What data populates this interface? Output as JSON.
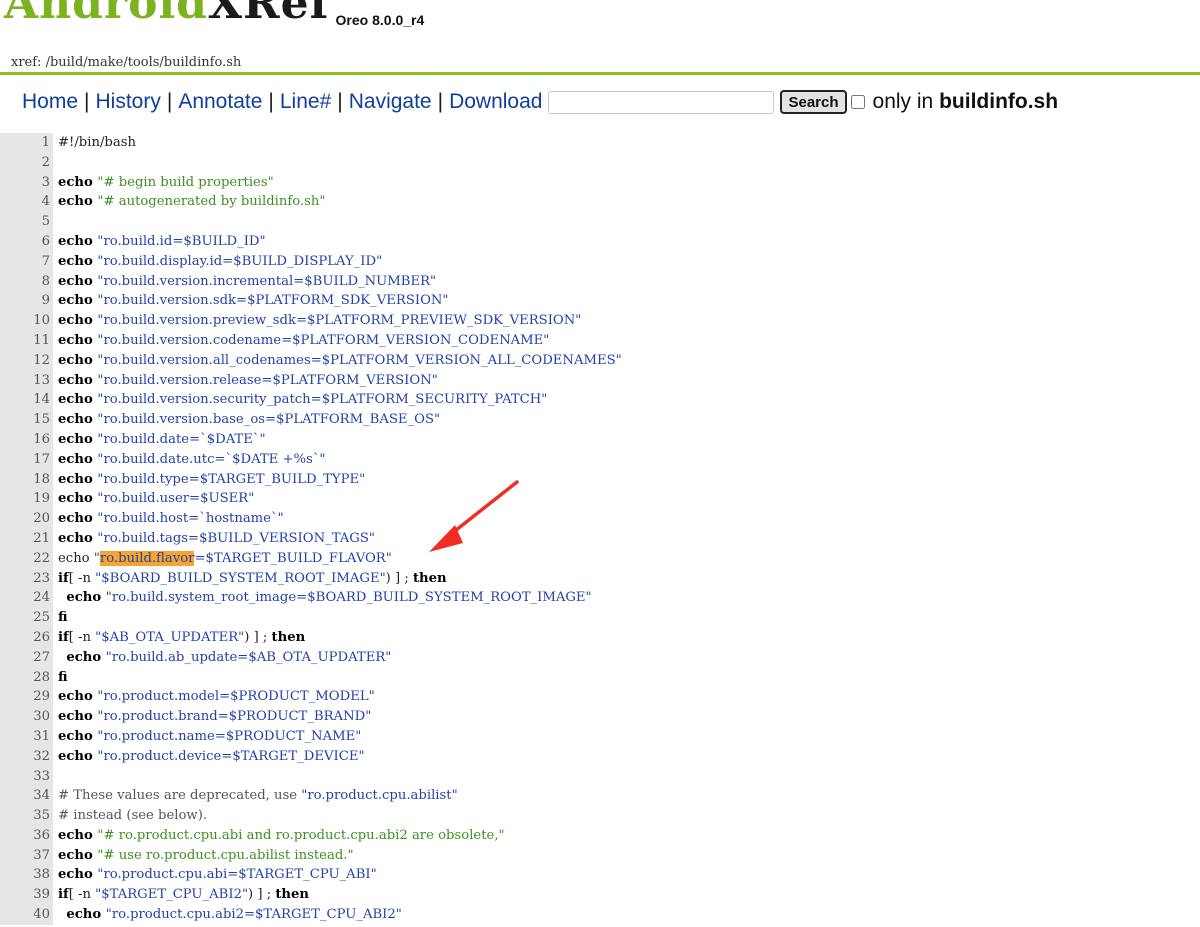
{
  "brand": {
    "title_prefix": "Android",
    "title_suffix": "XRef",
    "version": "Oreo 8.0.0_r4"
  },
  "path": {
    "label": "xref:",
    "segments": [
      "/build",
      "/make",
      "/tools",
      "/buildinfo.sh"
    ]
  },
  "nav": {
    "items": [
      "Home",
      "History",
      "Annotate",
      "Line#",
      "Navigate",
      "Download"
    ],
    "search_value": "",
    "search_button": "Search",
    "only_in_label": "only in",
    "only_in_file": "buildinfo.sh",
    "only_in_checked": false
  },
  "colors": {
    "brand_green": "#7cb21f",
    "link_blue": "#0f3f9c",
    "highlight_orange": "#f7a531",
    "arrow_red": "#ee2e24"
  },
  "code": {
    "lines": [
      {
        "n": "1",
        "t": [
          [
            "",
            "#!/bin/bash"
          ]
        ]
      },
      {
        "n": "2",
        "t": []
      },
      {
        "n": "3",
        "t": [
          [
            "kw",
            "echo "
          ],
          [
            "cmt",
            "\"# begin build properties\""
          ]
        ]
      },
      {
        "n": "4",
        "t": [
          [
            "kw",
            "echo "
          ],
          [
            "cmt",
            "\"# autogenerated by buildinfo.sh\""
          ]
        ]
      },
      {
        "n": "5",
        "t": []
      },
      {
        "n": "6",
        "t": [
          [
            "kw",
            "echo "
          ],
          [
            "str",
            "\"ro.build.id=$BUILD_ID\""
          ]
        ]
      },
      {
        "n": "7",
        "t": [
          [
            "kw",
            "echo "
          ],
          [
            "str",
            "\"ro.build.display.id=$BUILD_DISPLAY_ID\""
          ]
        ]
      },
      {
        "n": "8",
        "t": [
          [
            "kw",
            "echo "
          ],
          [
            "str",
            "\"ro.build.version.incremental=$BUILD_NUMBER\""
          ]
        ]
      },
      {
        "n": "9",
        "t": [
          [
            "kw",
            "echo "
          ],
          [
            "str",
            "\"ro.build.version.sdk=$PLATFORM_SDK_VERSION\""
          ]
        ]
      },
      {
        "n": "10",
        "t": [
          [
            "kw",
            "echo "
          ],
          [
            "str",
            "\"ro.build.version.preview_sdk=$PLATFORM_PREVIEW_SDK_VERSION\""
          ]
        ]
      },
      {
        "n": "11",
        "t": [
          [
            "kw",
            "echo "
          ],
          [
            "str",
            "\"ro.build.version.codename=$PLATFORM_VERSION_CODENAME\""
          ]
        ]
      },
      {
        "n": "12",
        "t": [
          [
            "kw",
            "echo "
          ],
          [
            "str",
            "\"ro.build.version.all_codenames=$PLATFORM_VERSION_ALL_CODENAMES\""
          ]
        ]
      },
      {
        "n": "13",
        "t": [
          [
            "kw",
            "echo "
          ],
          [
            "str",
            "\"ro.build.version.release=$PLATFORM_VERSION\""
          ]
        ]
      },
      {
        "n": "14",
        "t": [
          [
            "kw",
            "echo "
          ],
          [
            "str",
            "\"ro.build.version.security_patch=$PLATFORM_SECURITY_PATCH\""
          ]
        ]
      },
      {
        "n": "15",
        "t": [
          [
            "kw",
            "echo "
          ],
          [
            "str",
            "\"ro.build.version.base_os=$PLATFORM_BASE_OS\""
          ]
        ]
      },
      {
        "n": "16",
        "t": [
          [
            "kw",
            "echo "
          ],
          [
            "str",
            "\"ro.build.date=`$DATE`\""
          ]
        ]
      },
      {
        "n": "17",
        "t": [
          [
            "kw",
            "echo "
          ],
          [
            "str",
            "\"ro.build.date.utc=`$DATE +%s`\""
          ]
        ]
      },
      {
        "n": "18",
        "t": [
          [
            "kw",
            "echo "
          ],
          [
            "str",
            "\"ro.build.type=$TARGET_BUILD_TYPE\""
          ]
        ]
      },
      {
        "n": "19",
        "t": [
          [
            "kw",
            "echo "
          ],
          [
            "str",
            "\"ro.build.user=$USER\""
          ]
        ]
      },
      {
        "n": "20",
        "t": [
          [
            "kw",
            "echo "
          ],
          [
            "str",
            "\"ro.build.host=`hostname`\""
          ]
        ]
      },
      {
        "n": "21",
        "t": [
          [
            "kw",
            "echo "
          ],
          [
            "str",
            "\"ro.build.tags=$BUILD_VERSION_TAGS\""
          ]
        ]
      },
      {
        "n": "22",
        "t": [
          [
            "",
            "echo "
          ],
          [
            "str",
            "\""
          ],
          [
            "hl",
            "ro.build.flavor"
          ],
          [
            "str",
            "=$TARGET_BUILD_FLAVOR\""
          ]
        ]
      },
      {
        "n": "23",
        "t": [
          [
            "kw",
            "if"
          ],
          [
            "",
            "[ -n "
          ],
          [
            "str",
            "\"$BOARD_BUILD_SYSTEM_ROOT_IMAGE\""
          ],
          [
            "",
            ") ] ; "
          ],
          [
            "kw",
            "then"
          ]
        ]
      },
      {
        "n": "24",
        "t": [
          [
            "",
            "  "
          ],
          [
            "kw",
            "echo "
          ],
          [
            "str",
            "\"ro.build.system_root_image=$BOARD_BUILD_SYSTEM_ROOT_IMAGE\""
          ]
        ]
      },
      {
        "n": "25",
        "t": [
          [
            "kw",
            "fi"
          ]
        ]
      },
      {
        "n": "26",
        "t": [
          [
            "kw",
            "if"
          ],
          [
            "",
            "[ -n "
          ],
          [
            "str",
            "\"$AB_OTA_UPDATER\""
          ],
          [
            "",
            ") ] ; "
          ],
          [
            "kw",
            "then"
          ]
        ]
      },
      {
        "n": "27",
        "t": [
          [
            "",
            "  "
          ],
          [
            "kw",
            "echo "
          ],
          [
            "str",
            "\"ro.build.ab_update=$AB_OTA_UPDATER\""
          ]
        ]
      },
      {
        "n": "28",
        "t": [
          [
            "kw",
            "fi"
          ]
        ]
      },
      {
        "n": "29",
        "t": [
          [
            "kw",
            "echo "
          ],
          [
            "str",
            "\"ro.product.model=$PRODUCT_MODEL\""
          ]
        ]
      },
      {
        "n": "30",
        "t": [
          [
            "kw",
            "echo "
          ],
          [
            "str",
            "\"ro.product.brand=$PRODUCT_BRAND\""
          ]
        ]
      },
      {
        "n": "31",
        "t": [
          [
            "kw",
            "echo "
          ],
          [
            "str",
            "\"ro.product.name=$PRODUCT_NAME\""
          ]
        ]
      },
      {
        "n": "32",
        "t": [
          [
            "kw",
            "echo "
          ],
          [
            "str",
            "\"ro.product.device=$TARGET_DEVICE\""
          ]
        ]
      },
      {
        "n": "33",
        "t": []
      },
      {
        "n": "34",
        "t": [
          [
            "cmt2",
            "# These values are deprecated, use "
          ],
          [
            "str",
            "\"ro.product.cpu.abilist\""
          ]
        ]
      },
      {
        "n": "35",
        "t": [
          [
            "cmt2",
            "# instead (see below)."
          ]
        ]
      },
      {
        "n": "36",
        "t": [
          [
            "kw",
            "echo "
          ],
          [
            "cmt",
            "\"# ro.product.cpu.abi and ro.product.cpu.abi2 are obsolete,\""
          ]
        ]
      },
      {
        "n": "37",
        "t": [
          [
            "kw",
            "echo "
          ],
          [
            "cmt",
            "\"# use ro.product.cpu.abilist instead.\""
          ]
        ]
      },
      {
        "n": "38",
        "t": [
          [
            "kw",
            "echo "
          ],
          [
            "str",
            "\"ro.product.cpu.abi=$TARGET_CPU_ABI\""
          ]
        ]
      },
      {
        "n": "39",
        "t": [
          [
            "kw",
            "if"
          ],
          [
            "",
            "[ -n "
          ],
          [
            "str",
            "\"$TARGET_CPU_ABI2\""
          ],
          [
            "",
            ") ] ; "
          ],
          [
            "kw",
            "then"
          ]
        ]
      },
      {
        "n": "40",
        "t": [
          [
            "",
            "  "
          ],
          [
            "kw",
            "echo "
          ],
          [
            "str",
            "\"ro.product.cpu.abi2=$TARGET_CPU_ABI2\""
          ]
        ]
      }
    ]
  }
}
